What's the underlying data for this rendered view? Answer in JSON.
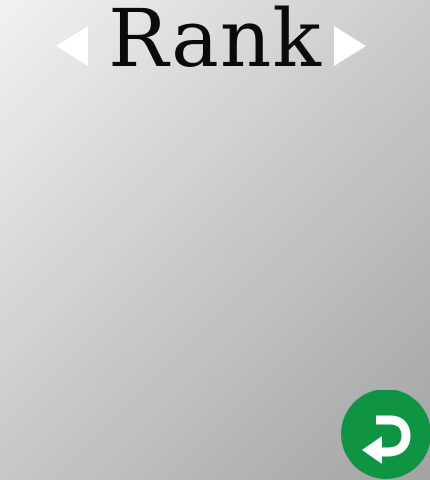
{
  "header": {
    "title": "Rank",
    "prev_icon": "left-triangle-icon",
    "next_icon": "right-triangle-icon"
  },
  "footer": {
    "back_icon": "return-arrow-icon",
    "back_color": "#0f9443"
  },
  "colors": {
    "background_light": "#f2f2f2",
    "background_dark": "#a3a3a3",
    "arrow": "#ffffff",
    "title": "#0a0a0a"
  }
}
